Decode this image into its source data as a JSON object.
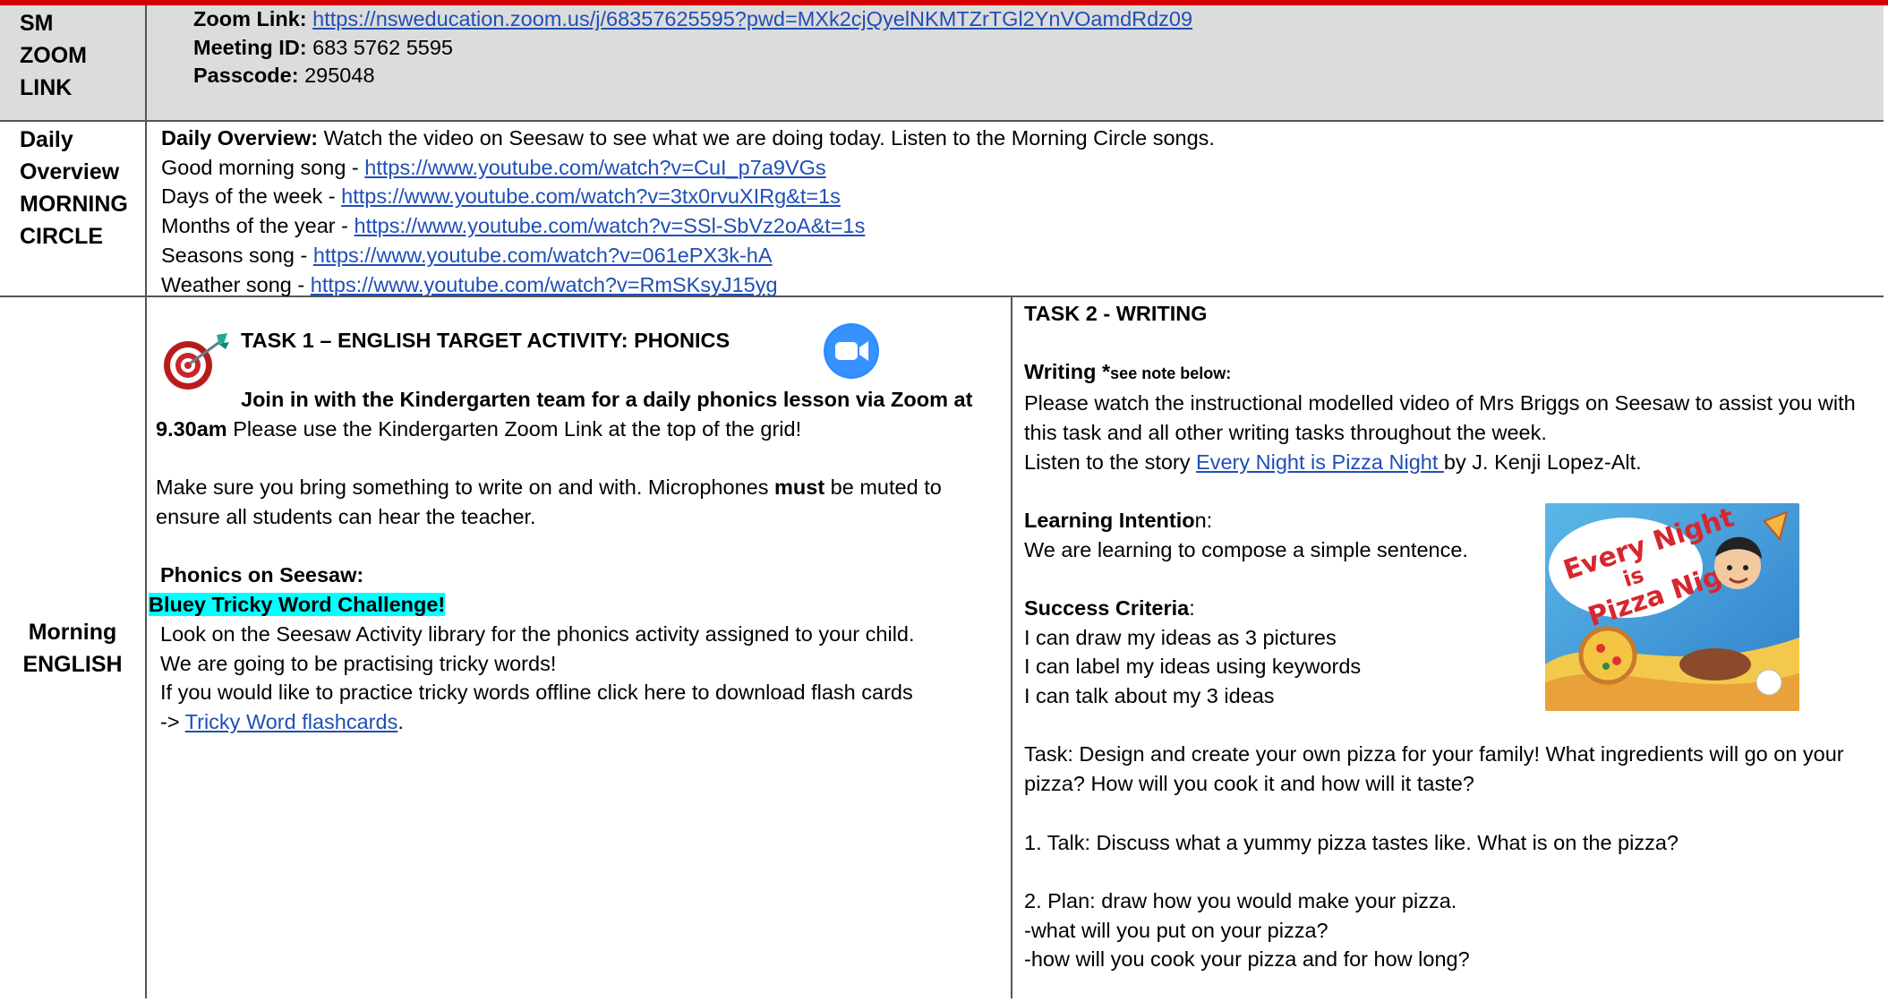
{
  "zoom_row": {
    "label_lines": [
      "SM",
      "ZOOM",
      "LINK"
    ],
    "link_label": "Zoom Link:",
    "link_url": "https://nsweducation.zoom.us/j/68357625595?pwd=MXk2cjQyelNKMTZrTGl2YnVOamdRdz09",
    "meeting_label": "Meeting ID:",
    "meeting_value": "683 5762 5595",
    "passcode_label": "Passcode:",
    "passcode_value": "295048"
  },
  "daily_row": {
    "label_lines": [
      "Daily",
      "Overview",
      "MORNING",
      "CIRCLE"
    ],
    "overview_label": "Daily Overview:",
    "overview_text": "Watch the video on Seesaw to see what we are doing today. Listen to the Morning Circle songs.",
    "songs": [
      {
        "name": "Good morning song - ",
        "url": "https://www.youtube.com/watch?v=CuI_p7a9VGs"
      },
      {
        "name": "Days of the week - ",
        "url": "https://www.youtube.com/watch?v=3tx0rvuXIRg&t=1s"
      },
      {
        "name": "Months of the year - ",
        "url": "https://www.youtube.com/watch?v=SSl-SbVz2oA&t=1s"
      },
      {
        "name": "Seasons song - ",
        "url": "https://www.youtube.com/watch?v=061ePX3k-hA"
      },
      {
        "name": "Weather song - ",
        "url": "https://www.youtube.com/watch?v=RmSKsyJ15yg"
      }
    ]
  },
  "morning_row": {
    "label_lines": [
      "Morning",
      "ENGLISH"
    ],
    "task1": {
      "title": "TASK 1 – ENGLISH TARGET ACTIVITY: PHONICS",
      "join_bold": "Join in with the Kindergarten team for a daily phonics lesson via Zoom at",
      "time_bold": "9.30am",
      "join_rest": " Please use the Kindergarten Zoom Link at the top of the grid!",
      "mics_pre": "Make sure you bring something to write on and with. Microphones ",
      "mics_bold": "must",
      "mics_post": " be muted to ensure all students can hear the teacher.",
      "phonics_heading": "Phonics on Seesaw:",
      "highlight": "Bluey Tricky Word Challenge!",
      "line1": "Look on the Seesaw Activity library for the phonics activity assigned to your child.",
      "line2": "We are going to be practising tricky words!",
      "line3": "If you would like to practice tricky words offline click here to download flash cards",
      "arrow": "-> ",
      "flash_link": "Tricky Word flashcards",
      "period": "."
    },
    "task2": {
      "title": "TASK 2 - WRITING",
      "writing_label": "Writing *",
      "writing_note": "see note below:",
      "instr": "Please watch the instructional modelled video of Mrs Briggs on Seesaw to assist you with this task and all other writing tasks throughout the week.",
      "story_pre": "Listen to the story ",
      "story_link": "Every Night is Pizza Night ",
      "story_post": "by J. Kenji Lopez-Alt.",
      "li_label": "Learning Intentio",
      "li_suffix": "n:",
      "li_text": "We are learning to compose a simple sentence.",
      "sc_label": "Success Criteria",
      "sc_colon": ":",
      "criteria": [
        "I can draw my ideas as 3 pictures",
        "I can label my ideas using keywords",
        "I can talk about my 3 ideas"
      ],
      "task_text": "Task: Design and create your own pizza for your family! What ingredients will go on your pizza? How will you cook it and how will it taste?",
      "step1": "1. Talk: Discuss what a yummy pizza tastes like. What is on the pizza?",
      "step2": "2. Plan: draw how you would make your pizza.",
      "step2a": "-what will you put on your pizza?",
      "step2b": "-how will you cook your pizza and for how long?",
      "book_title_1": "Every Night",
      "book_title_2": "is",
      "book_title_3": "Pizza Night"
    }
  },
  "colors": {
    "link": "#1f4fb6",
    "highlight": "#00ffff",
    "top_bg": "#dcdcdc",
    "top_border": "#d40000"
  }
}
